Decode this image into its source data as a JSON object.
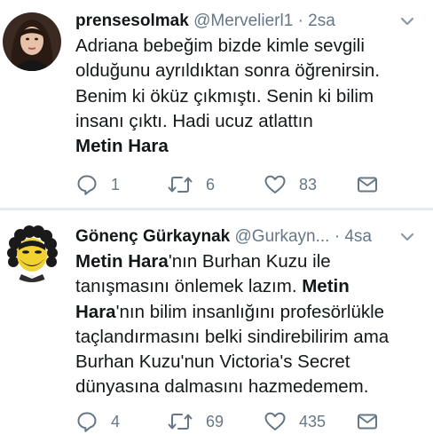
{
  "tweets": [
    {
      "display_name": "prensesolmak",
      "handle": "@Mervelierl1",
      "separator": "·",
      "time": "2sa",
      "text_lines": [
        "Adriana bebeğim bizde kimle sevgili",
        "olduğunu ayrıldıktan sonra öğrenirsin.",
        "Benim ki öküz çıkmıştı.  Senin ki bilim",
        "insanı çıktı. Hadi ucuz atlattın"
      ],
      "mention": "Metin Hara",
      "replies": "1",
      "retweets": "6",
      "likes": "83",
      "avatar_icon": "profile-photo-woman"
    },
    {
      "display_name": "Gönenç Gürkaynak",
      "handle": "@Gurkayn...",
      "separator": "·",
      "time": "4sa",
      "segments": {
        "l1_bold": "Metin Hara",
        "l1_rest": "'nın Burhan Kuzu ile",
        "l2_start": "tanışmasını önlemek lazım. ",
        "l2_bold": "Metin",
        "l3_bold": "Hara",
        "l3_rest": "'nın bilim insanlığını profesörlükle",
        "l4": "taçlandırmasını belki sindirebilirim ama",
        "l5": "Burhan Kuzu'nun Victoria's Secret",
        "l6": "dünyasına dalmasını hazmedemem."
      },
      "replies": "4",
      "retweets": "69",
      "likes": "435",
      "avatar_icon": "cartoon-avatar-curly-hair"
    }
  ],
  "colors": {
    "text": "#14171a",
    "secondary": "#657786",
    "divider": "#e6ecf0",
    "avatar_bg": "#f2d230"
  },
  "icons": [
    "reply-icon",
    "retweet-icon",
    "like-icon",
    "dm-icon",
    "chevron-down-icon"
  ]
}
